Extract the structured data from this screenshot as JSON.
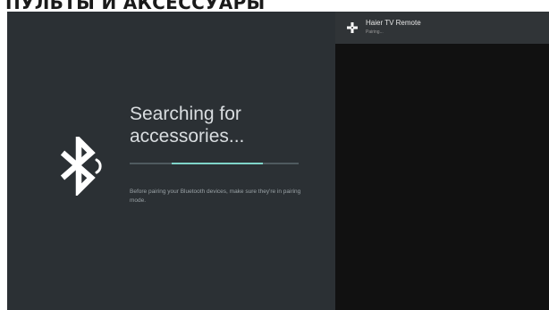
{
  "page_heading": "ПУЛЬТЫ И АКСЕССУАРЫ",
  "pairing": {
    "title": "Searching for accessories...",
    "hint": "Before pairing your Bluetooth devices, make sure they're in pairing mode.",
    "progress": {
      "start_fraction": 0.25,
      "end_fraction": 0.79
    },
    "icon": "bluetooth-searching-icon"
  },
  "devices": [
    {
      "name": "Haier  TV Remote",
      "status": "Pairing...",
      "icon": "gamepad-icon"
    }
  ],
  "colors": {
    "left_panel": "#2b3034",
    "right_panel": "#111111",
    "accent": "#7fd3c8",
    "selected_row": "#303437"
  }
}
